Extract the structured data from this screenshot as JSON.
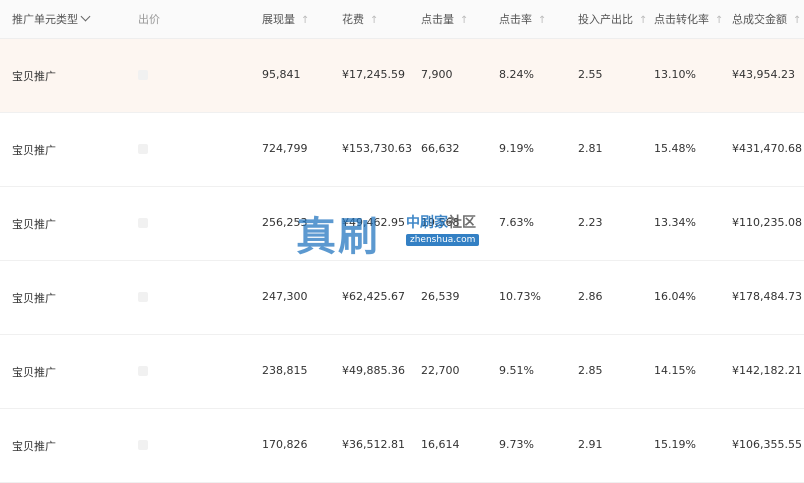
{
  "header": {
    "type_col": "推广单元类型",
    "bid_col": "出价",
    "impressions_col": "展现量",
    "spend_col": "花费",
    "clicks_col": "点击量",
    "ctr_col": "点击率",
    "roi_col": "投入产出比",
    "cvr_col": "点击转化率",
    "gmv_col": "总成交金额",
    "sort_glyph": "↑"
  },
  "rows": [
    {
      "type": "宝贝推广",
      "impressions": "95,841",
      "spend": "¥17,245.59",
      "clicks": "7,900",
      "ctr": "8.24%",
      "roi": "2.55",
      "cvr": "13.10%",
      "gmv": "¥43,954.23",
      "highlight": true
    },
    {
      "type": "宝贝推广",
      "impressions": "724,799",
      "spend": "¥153,730.63",
      "clicks": "66,632",
      "ctr": "9.19%",
      "roi": "2.81",
      "cvr": "15.48%",
      "gmv": "¥431,470.68",
      "highlight": false
    },
    {
      "type": "宝贝推广",
      "impressions": "256,253",
      "spend": "¥49,462.95",
      "clicks": "19,568",
      "ctr": "7.63%",
      "roi": "2.23",
      "cvr": "13.34%",
      "gmv": "¥110,235.08",
      "highlight": false
    },
    {
      "type": "宝贝推广",
      "impressions": "247,300",
      "spend": "¥62,425.67",
      "clicks": "26,539",
      "ctr": "10.73%",
      "roi": "2.86",
      "cvr": "16.04%",
      "gmv": "¥178,484.73",
      "highlight": false
    },
    {
      "type": "宝贝推广",
      "impressions": "238,815",
      "spend": "¥49,885.36",
      "clicks": "22,700",
      "ctr": "9.51%",
      "roi": "2.85",
      "cvr": "14.15%",
      "gmv": "¥142,182.21",
      "highlight": false
    },
    {
      "type": "宝贝推广",
      "impressions": "170,826",
      "spend": "¥36,512.81",
      "clicks": "16,614",
      "ctr": "9.73%",
      "roi": "2.91",
      "cvr": "15.19%",
      "gmv": "¥106,355.55",
      "highlight": false
    }
  ],
  "watermark": {
    "logo": "真刷",
    "title_a": "中",
    "title_b": "刷",
    "title_c": "家",
    "title_d": "社区",
    "url": "zhenshua.com"
  },
  "colors": {
    "highlight_row": "#fdf6f1",
    "header_bg": "#fafafa",
    "watermark_blue": "#1e73be"
  }
}
